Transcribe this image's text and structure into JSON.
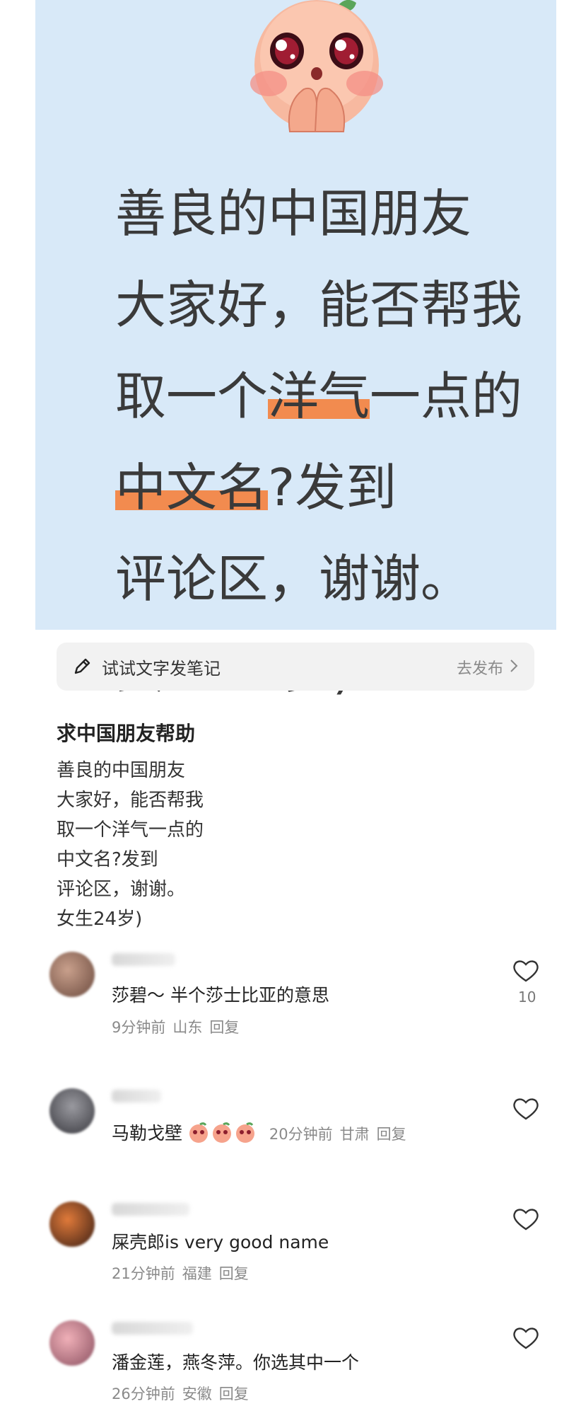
{
  "cover": {
    "lines": [
      {
        "parts": [
          {
            "text": "善良的中国朋友"
          }
        ]
      },
      {
        "parts": [
          {
            "text": "大家好，能否帮我"
          }
        ]
      },
      {
        "parts": [
          {
            "text": "取一个"
          },
          {
            "text": "洋气",
            "hl": true
          },
          {
            "text": "一点的"
          }
        ]
      },
      {
        "parts": [
          {
            "text": "中文名",
            "hl": true
          },
          {
            "text": "?发到"
          }
        ]
      },
      {
        "parts": [
          {
            "text": "评论区，谢谢。"
          }
        ]
      },
      {
        "parts": [
          {
            "text": "女生24岁)"
          }
        ]
      }
    ],
    "bg_color": "#d8e9f8",
    "highlight_color": "#f28b4f"
  },
  "note_bar": {
    "label": "试试文字发笔记",
    "action": "去发布",
    "icon": "pen-icon"
  },
  "post": {
    "title": "求中国朋友帮助",
    "body": [
      "善良的中国朋友",
      "大家好，能否帮我",
      "取一个洋气一点的",
      "中文名?发到",
      "评论区，谢谢。",
      "女生24岁)"
    ]
  },
  "comments": [
    {
      "text": "莎碧～ 半个莎士比亚的意思",
      "time": "9分钟前",
      "location": "山东",
      "reply": "回复",
      "likes": "10"
    },
    {
      "text": "马勒戈壁",
      "emoji_count": 3,
      "time": "20分钟前",
      "location": "甘肃",
      "reply": "回复",
      "likes": ""
    },
    {
      "text": "屎壳郎is very good name",
      "time": "21分钟前",
      "location": "福建",
      "reply": "回复",
      "likes": ""
    },
    {
      "text": "潘金莲，燕冬萍。你选其中一个",
      "time": "26分钟前",
      "location": "安徽",
      "reply": "回复",
      "likes": ""
    }
  ]
}
